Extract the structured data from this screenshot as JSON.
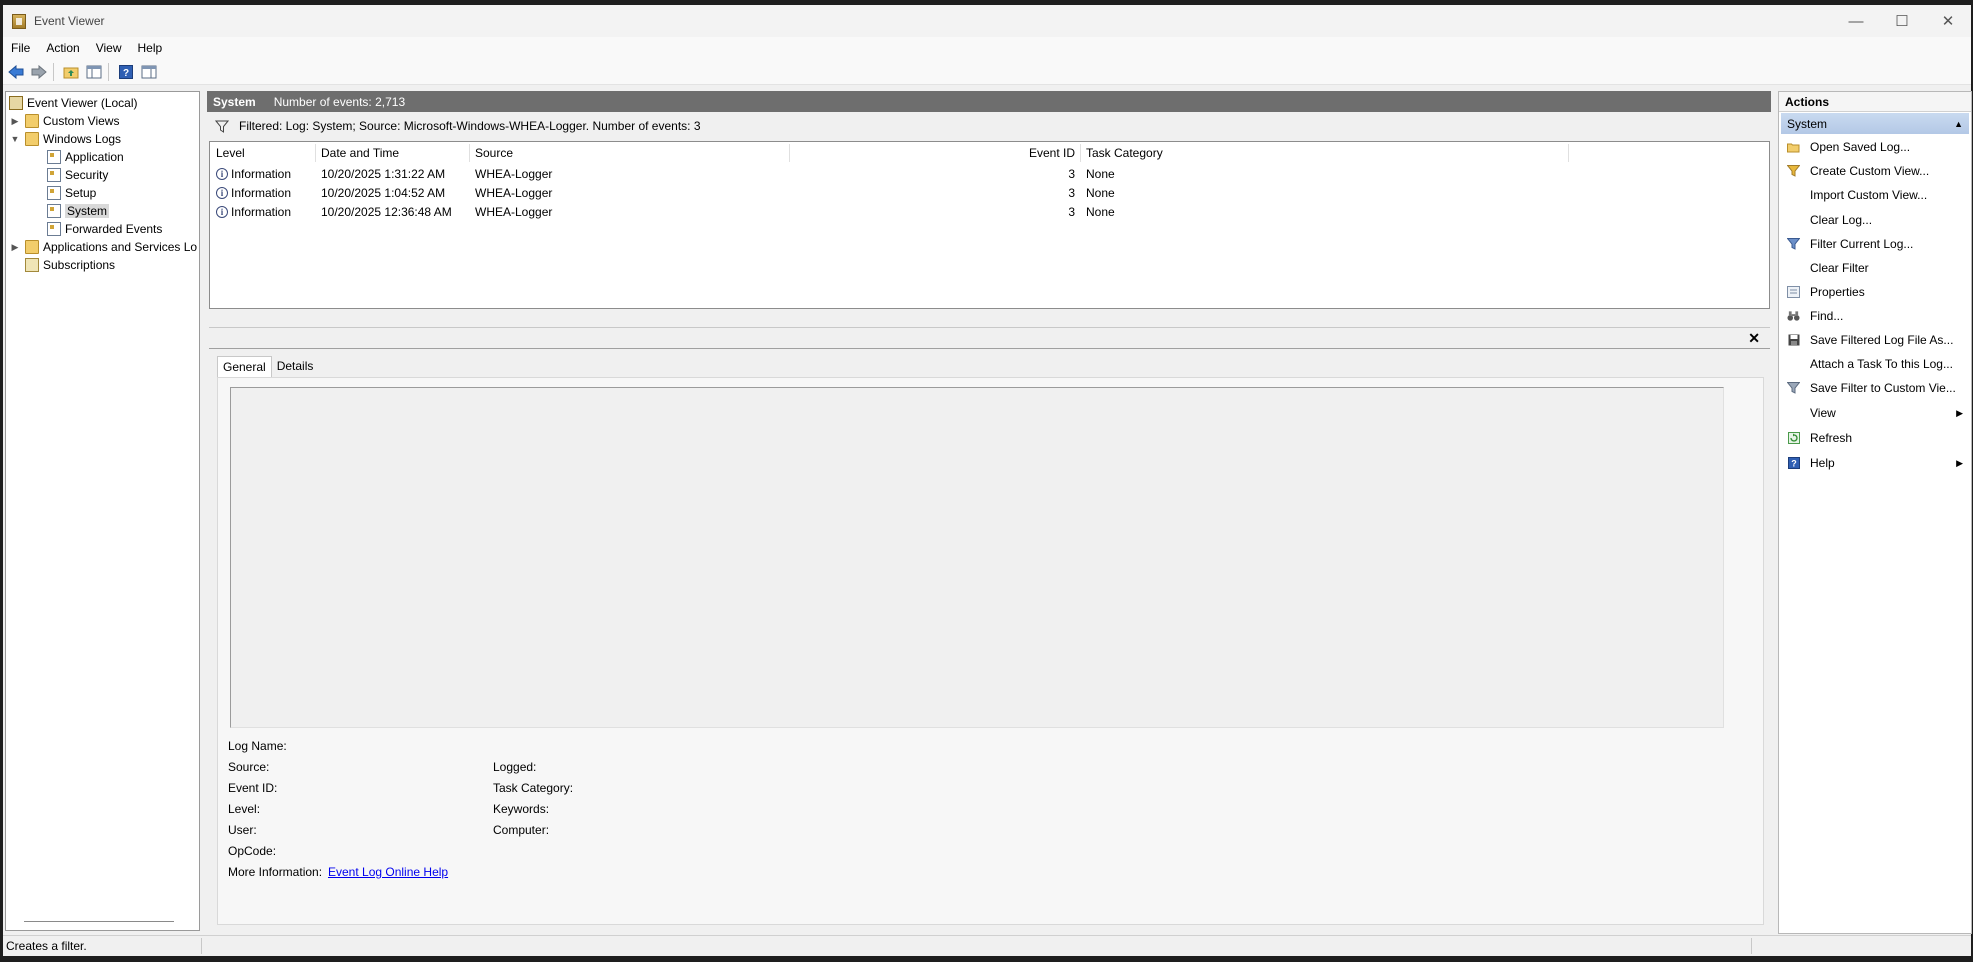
{
  "window": {
    "title": "Event Viewer",
    "controls": {
      "minimize": "—",
      "maximize": "☐",
      "close": "✕"
    }
  },
  "menu": [
    "File",
    "Action",
    "View",
    "Help"
  ],
  "toolbar": {
    "buttons": [
      "back-icon",
      "forward-icon",
      "up-folder-icon",
      "show-hide-tree-icon",
      "help-icon",
      "show-hide-action-pane-icon"
    ]
  },
  "tree": {
    "root": "Event Viewer (Local)",
    "custom_views": "Custom Views",
    "windows_logs": "Windows Logs",
    "logs": [
      "Application",
      "Security",
      "Setup",
      "System",
      "Forwarded Events"
    ],
    "apps_services": "Applications and Services Lo",
    "subscriptions": "Subscriptions",
    "selected": "System"
  },
  "header": {
    "title": "System",
    "count": "Number of events: 2,713"
  },
  "filter": {
    "text": "Filtered: Log: System; Source: Microsoft-Windows-WHEA-Logger. Number of events: 3"
  },
  "columns": {
    "level": "Level",
    "date": "Date and Time",
    "source": "Source",
    "event_id": "Event ID",
    "task": "Task Category"
  },
  "events": [
    {
      "level": "Information",
      "date": "10/20/2025 1:31:22 AM",
      "source": "WHEA-Logger",
      "event_id": "3",
      "task": "None"
    },
    {
      "level": "Information",
      "date": "10/20/2025 1:04:52 AM",
      "source": "WHEA-Logger",
      "event_id": "3",
      "task": "None"
    },
    {
      "level": "Information",
      "date": "10/20/2025 12:36:48 AM",
      "source": "WHEA-Logger",
      "event_id": "3",
      "task": "None"
    }
  ],
  "details": {
    "close": "✕",
    "tabs": [
      "General",
      "Details"
    ],
    "active_tab": "General",
    "fields_left": [
      "Log Name:",
      "Source:",
      "Event ID:",
      "Level:",
      "User:",
      "OpCode:"
    ],
    "fields_right": [
      "Logged:",
      "Task Category:",
      "Keywords:",
      "Computer:"
    ],
    "more_info_label": "More Information:",
    "more_info_link": "Event Log Online Help"
  },
  "actions": {
    "header": "Actions",
    "section": "System",
    "items": [
      {
        "label": "Open Saved Log...",
        "icon": "open-folder-icon"
      },
      {
        "label": "Create Custom View...",
        "icon": "create-filter-icon"
      },
      {
        "label": "Import Custom View...",
        "icon": ""
      },
      {
        "label": "Clear Log...",
        "icon": ""
      },
      {
        "label": "Filter Current Log...",
        "icon": "filter-icon"
      },
      {
        "label": "Clear Filter",
        "icon": ""
      },
      {
        "label": "Properties",
        "icon": "properties-icon"
      },
      {
        "label": "Find...",
        "icon": "binoculars-icon"
      },
      {
        "label": "Save Filtered Log File As...",
        "icon": "save-icon"
      },
      {
        "label": "Attach a Task To this Log...",
        "icon": ""
      },
      {
        "label": "Save Filter to Custom Vie...",
        "icon": "save-filter-icon"
      },
      {
        "label": "View",
        "icon": "",
        "submenu": true
      },
      {
        "label": "Refresh",
        "icon": "refresh-icon"
      },
      {
        "label": "Help",
        "icon": "help-icon",
        "submenu": true
      }
    ]
  },
  "status": {
    "text": "Creates a filter."
  },
  "colors": {
    "header_bar": "#6e6e6e",
    "actions_section": "#c9daf0",
    "link": "#0000ee"
  }
}
